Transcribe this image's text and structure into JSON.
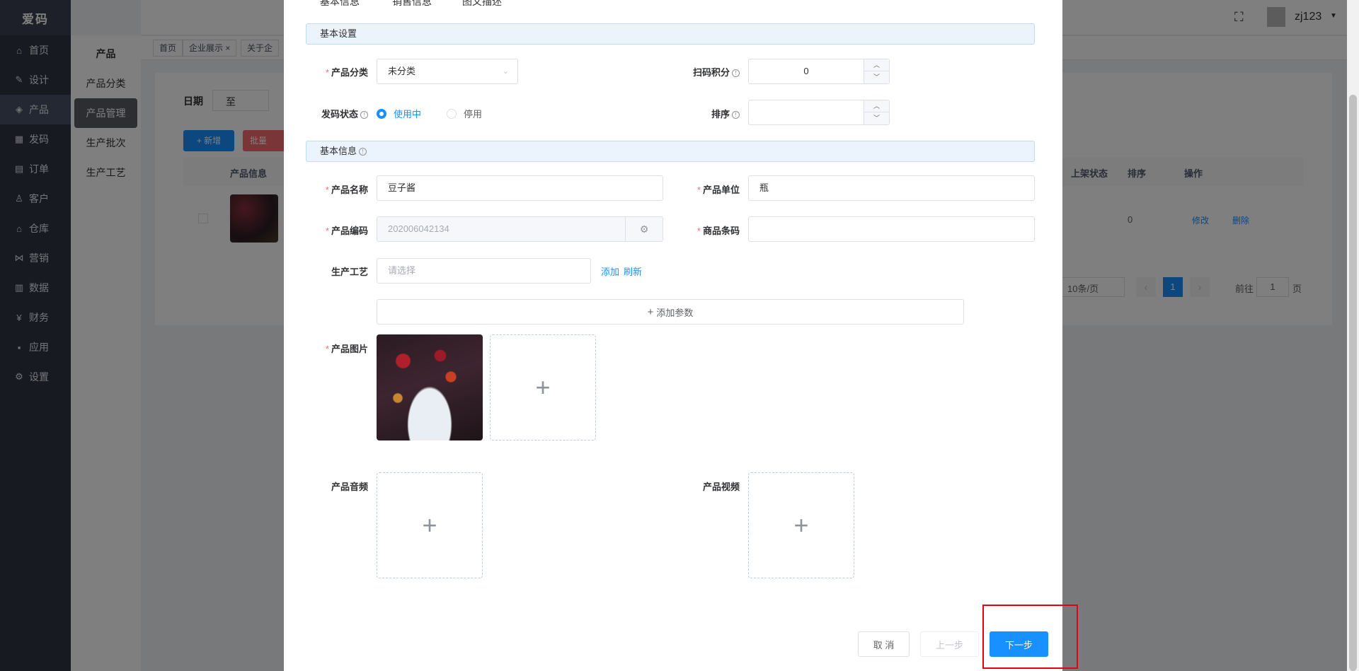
{
  "app": {
    "logo_text": "爱码",
    "user": "zj123"
  },
  "sidebar": {
    "items": [
      {
        "label": "首页",
        "icon": "home-icon",
        "glyph": "⌂"
      },
      {
        "label": "设计",
        "icon": "design-icon",
        "glyph": "✎"
      },
      {
        "label": "产品",
        "icon": "box-icon",
        "glyph": "◈"
      },
      {
        "label": "发码",
        "icon": "grid-icon",
        "glyph": "▦"
      },
      {
        "label": "订单",
        "icon": "order-icon",
        "glyph": "▤"
      },
      {
        "label": "客户",
        "icon": "customer-icon",
        "glyph": "♙"
      },
      {
        "label": "仓库",
        "icon": "warehouse-icon",
        "glyph": "⌂"
      },
      {
        "label": "营销",
        "icon": "share-icon",
        "glyph": "⋈"
      },
      {
        "label": "数据",
        "icon": "chart-icon",
        "glyph": "▥"
      },
      {
        "label": "财务",
        "icon": "finance-icon",
        "glyph": "¥"
      },
      {
        "label": "应用",
        "icon": "apps-icon",
        "glyph": "▪"
      },
      {
        "label": "设置",
        "icon": "gear-icon",
        "glyph": "⚙"
      }
    ]
  },
  "submenu": {
    "title": "产品",
    "items": [
      "产品分类",
      "产品管理",
      "生产批次",
      "生产工艺"
    ]
  },
  "tags": [
    "首页",
    "企业展示",
    "关于企"
  ],
  "background_page": {
    "date_label": "日期",
    "date_sep": "至",
    "add_btn": "+ 新增",
    "batch_btn": "批量",
    "col_product": "产品信息",
    "col_status": "上架状态",
    "col_sort": "排序",
    "col_ops": "操作",
    "row_sort": "0",
    "row_edit": "修改",
    "row_delete": "删除",
    "page_size": "10条/页",
    "page_current": "1",
    "goto_label": "前往",
    "goto_value": "1",
    "page_suffix": "页"
  },
  "dialog": {
    "tabs": [
      "基本信息",
      "销售信息",
      "图文描述"
    ],
    "section_basic_settings": "基本设置",
    "section_basic_info": "基本信息",
    "category_label": "产品分类",
    "category_value": "未分类",
    "scan_points_label": "扫码积分",
    "scan_points_value": "0",
    "code_status_label": "发码状态",
    "status_active": "使用中",
    "status_inactive": "停用",
    "sort_label": "排序",
    "sort_value": "",
    "name_label": "产品名称",
    "name_value": "豆子酱",
    "unit_label": "产品单位",
    "unit_value": "瓶",
    "code_label": "产品编码",
    "code_value": "202006042134",
    "barcode_label": "商品条码",
    "barcode_value": "",
    "craft_label": "生产工艺",
    "craft_placeholder": "请选择",
    "craft_add": "添加",
    "craft_refresh": "刷新",
    "add_param": "添加参数",
    "image_label": "产品图片",
    "audio_label": "产品音频",
    "video_label": "产品视频",
    "cancel_btn": "取 消",
    "prev_btn": "上一步",
    "next_btn": "下一步"
  },
  "colors": {
    "primary": "#1890ff",
    "sidebar_bg": "#2f3542",
    "highlight_box": "#e60012",
    "danger": "#f56c6c"
  }
}
